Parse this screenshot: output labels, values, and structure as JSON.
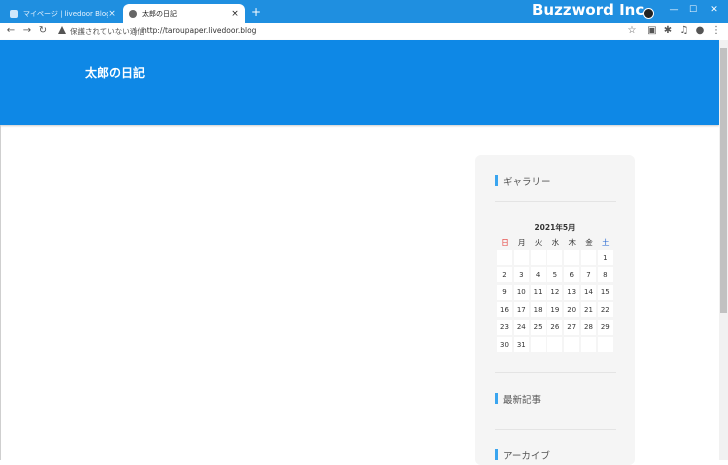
{
  "browser": {
    "tabs": [
      {
        "title": "マイページ | livedoor Blog",
        "close": "×"
      },
      {
        "title": "太郎の日記",
        "close": "×"
      }
    ],
    "new_tab": "+",
    "brand": "Buzzword Inc.",
    "window_controls": {
      "minimize": "—",
      "maximize": "☐",
      "close": "✕"
    },
    "nav": {
      "back": "←",
      "forward": "→",
      "reload": "↻"
    },
    "address": {
      "security_text": "保護されていない通信",
      "url": "http://taroupaper.livedoor.blog"
    },
    "toolbar_icons": {
      "star": "☆",
      "extensions": "✱",
      "media": "♫",
      "profile": "●",
      "menu": "⋮",
      "cast": "▣"
    }
  },
  "page": {
    "blog_title": "太郎の日記",
    "widgets": {
      "gallery": "ギャラリー",
      "recent": "最新記事",
      "archive": "アーカイブ"
    },
    "calendar": {
      "title": "2021年5月",
      "weekdays": [
        "日",
        "月",
        "火",
        "水",
        "木",
        "金",
        "土"
      ],
      "weekday_colors": {
        "sun": "#e53935",
        "sat": "#1e62d0"
      },
      "weeks": [
        [
          "",
          "",
          "",
          "",
          "",
          "",
          "1"
        ],
        [
          "2",
          "3",
          "4",
          "5",
          "6",
          "7",
          "8"
        ],
        [
          "9",
          "10",
          "11",
          "12",
          "13",
          "14",
          "15"
        ],
        [
          "16",
          "17",
          "18",
          "19",
          "20",
          "21",
          "22"
        ],
        [
          "23",
          "24",
          "25",
          "26",
          "27",
          "28",
          "29"
        ],
        [
          "30",
          "31",
          "",
          "",
          "",
          "",
          ""
        ]
      ]
    }
  },
  "colors": {
    "chrome": "#1f8fe0",
    "header": "#0e88e6",
    "accent_bar": "#3aa5ef"
  }
}
